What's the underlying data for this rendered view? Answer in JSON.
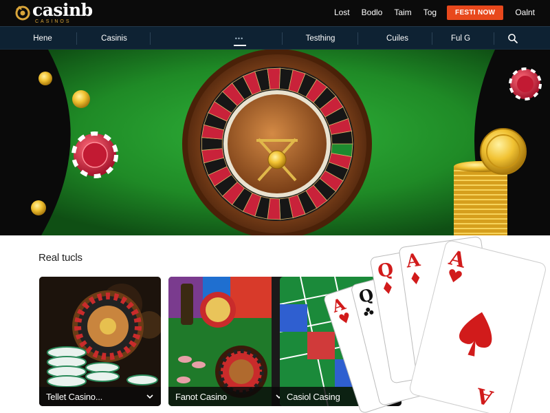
{
  "brand": {
    "name": "casinb",
    "tagline": "CASINOS",
    "colors": {
      "gold": "#d9a53a",
      "accent": "#e8481c",
      "nav": "#0e2233",
      "felt": "#1f8a26"
    }
  },
  "header": {
    "links": [
      "Lost",
      "Bodlo",
      "Taim",
      "Tog"
    ],
    "cta": "FESTI NOW",
    "account": "Oalnt"
  },
  "nav": {
    "items": [
      "Hene",
      "Casinis",
      "•••",
      "Testhing",
      "Cuiles",
      "Ful G"
    ],
    "active_index": 2,
    "search_icon": "search-icon"
  },
  "hero": {
    "icons": [
      "roulette-wheel",
      "poker-chip",
      "gold-coin",
      "coin-stack"
    ]
  },
  "section": {
    "title": "Real tucls"
  },
  "cards": [
    {
      "label": "Tellet Casino...",
      "icon": "chevron-down-icon"
    },
    {
      "label": "Fanot Casino",
      "icon": "chevron-down-icon"
    },
    {
      "label": "Casiol Casing",
      "icon": "chevron-down-icon"
    }
  ],
  "playing_cards": {
    "ranks": [
      "A",
      "Q",
      "Q",
      "A",
      "A"
    ],
    "suits": [
      "hearts",
      "clubs",
      "diamonds",
      "diamonds",
      "spades"
    ]
  }
}
